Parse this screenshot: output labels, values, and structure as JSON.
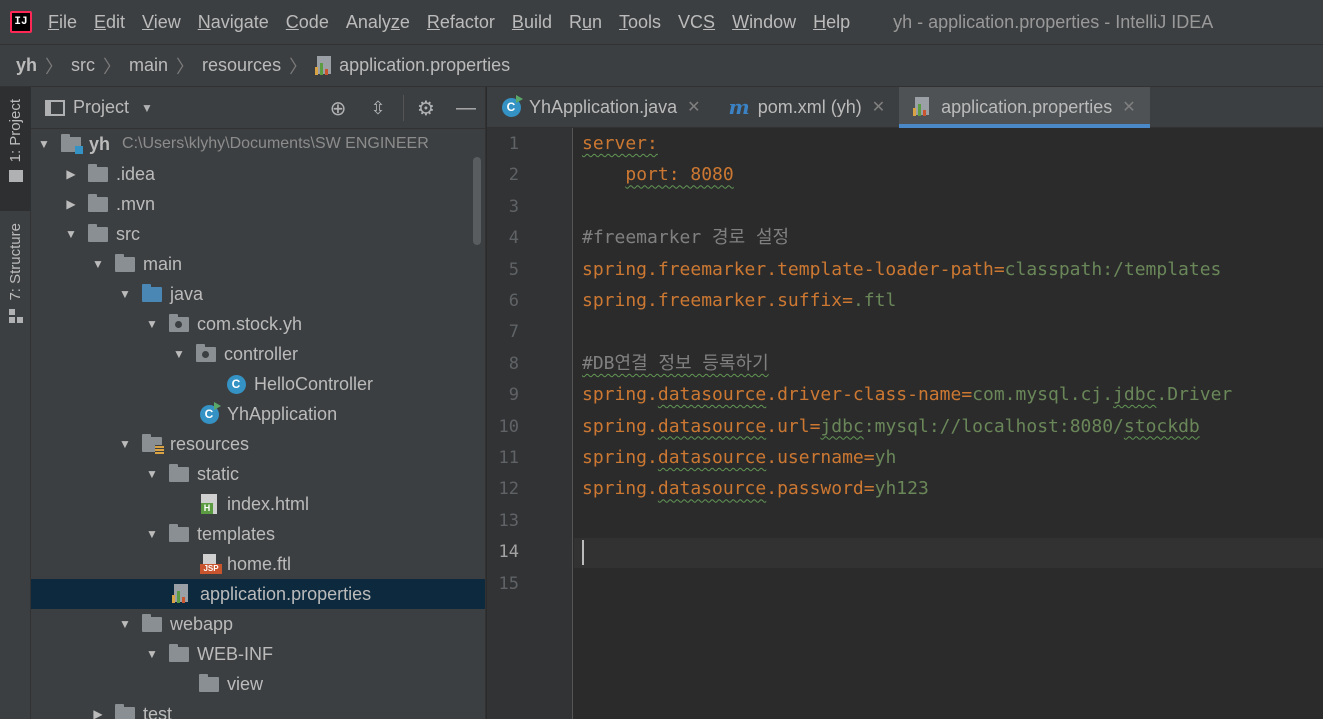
{
  "menu": {
    "items": [
      {
        "pre": "",
        "mn": "F",
        "post": "ile"
      },
      {
        "pre": "",
        "mn": "E",
        "post": "dit"
      },
      {
        "pre": "",
        "mn": "V",
        "post": "iew"
      },
      {
        "pre": "",
        "mn": "N",
        "post": "avigate"
      },
      {
        "pre": "",
        "mn": "C",
        "post": "ode"
      },
      {
        "pre": "Analy",
        "mn": "z",
        "post": "e"
      },
      {
        "pre": "",
        "mn": "R",
        "post": "efactor"
      },
      {
        "pre": "",
        "mn": "B",
        "post": "uild"
      },
      {
        "pre": "R",
        "mn": "u",
        "post": "n"
      },
      {
        "pre": "",
        "mn": "T",
        "post": "ools"
      },
      {
        "pre": "VC",
        "mn": "S",
        "post": ""
      },
      {
        "pre": "",
        "mn": "W",
        "post": "indow"
      },
      {
        "pre": "",
        "mn": "H",
        "post": "elp"
      }
    ],
    "window_title": "yh - application.properties - IntelliJ IDEA",
    "logo_text": "IJ"
  },
  "breadcrumb": [
    "yh",
    "src",
    "main",
    "resources",
    "application.properties"
  ],
  "toolstrip": {
    "project_label": "1: Project",
    "structure_label": "7: Structure"
  },
  "project_panel": {
    "title": "Project",
    "tree": [
      {
        "label": "yh",
        "path": "C:\\Users\\klyhy\\Documents\\SW ENGINEER",
        "indent": 0,
        "arrow": "▼",
        "icon": "folder-module",
        "bold": true
      },
      {
        "label": ".idea",
        "indent": 1,
        "arrow": "▶",
        "icon": "folder"
      },
      {
        "label": ".mvn",
        "indent": 1,
        "arrow": "▶",
        "icon": "folder"
      },
      {
        "label": "src",
        "indent": 1,
        "arrow": "▼",
        "icon": "folder"
      },
      {
        "label": "main",
        "indent": 2,
        "arrow": "▼",
        "icon": "folder"
      },
      {
        "label": "java",
        "indent": 3,
        "arrow": "▼",
        "icon": "folder-src"
      },
      {
        "label": "com.stock.yh",
        "indent": 4,
        "arrow": "▼",
        "icon": "folder-pkg"
      },
      {
        "label": "controller",
        "indent": 5,
        "arrow": "▼",
        "icon": "folder-pkg"
      },
      {
        "label": "HelloController",
        "indent": 7,
        "arrow": "",
        "icon": "class"
      },
      {
        "label": "YhApplication",
        "indent": 6,
        "arrow": "",
        "icon": "class-run"
      },
      {
        "label": "resources",
        "indent": 3,
        "arrow": "▼",
        "icon": "folder-res"
      },
      {
        "label": "static",
        "indent": 4,
        "arrow": "▼",
        "icon": "folder"
      },
      {
        "label": "index.html",
        "indent": 6,
        "arrow": "",
        "icon": "html"
      },
      {
        "label": "templates",
        "indent": 4,
        "arrow": "▼",
        "icon": "folder"
      },
      {
        "label": "home.ftl",
        "indent": 6,
        "arrow": "",
        "icon": "jsp"
      },
      {
        "label": "application.properties",
        "indent": 5,
        "arrow": "",
        "icon": "props",
        "selected": true
      },
      {
        "label": "webapp",
        "indent": 3,
        "arrow": "▼",
        "icon": "folder"
      },
      {
        "label": "WEB-INF",
        "indent": 4,
        "arrow": "▼",
        "icon": "folder"
      },
      {
        "label": "view",
        "indent": 6,
        "arrow": "",
        "icon": "folder"
      },
      {
        "label": "test",
        "indent": 2,
        "arrow": "▶",
        "icon": "folder"
      }
    ]
  },
  "tabs": [
    {
      "label": "YhApplication.java",
      "icon": "class-run",
      "active": false
    },
    {
      "label": "pom.xml (yh)",
      "icon": "maven",
      "active": false
    },
    {
      "label": "application.properties",
      "icon": "props",
      "active": true
    }
  ],
  "editor": {
    "current_line": 14,
    "line_count": 15,
    "lines": [
      [
        {
          "t": "server:",
          "c": "key",
          "w": true
        }
      ],
      [
        {
          "t": "    "
        },
        {
          "t": "port: 8080",
          "c": "key",
          "w": true
        }
      ],
      [],
      [
        {
          "t": "#freemarker 경로 설정",
          "c": "cmt"
        }
      ],
      [
        {
          "t": "spring.freemarker.template-loader-path",
          "c": "key"
        },
        {
          "t": "=",
          "c": "key"
        },
        {
          "t": "classpath:/templates",
          "c": "val"
        }
      ],
      [
        {
          "t": "spring.freemarker.suffix",
          "c": "key"
        },
        {
          "t": "=",
          "c": "key"
        },
        {
          "t": ".ftl",
          "c": "val"
        }
      ],
      [],
      [
        {
          "t": "#DB연결 정보 등록하기",
          "c": "cmt",
          "w": true
        }
      ],
      [
        {
          "t": "spring.",
          "c": "key"
        },
        {
          "t": "datasource",
          "c": "key",
          "w": true
        },
        {
          "t": ".driver-class-name",
          "c": "key"
        },
        {
          "t": "=",
          "c": "key"
        },
        {
          "t": "com.mysql.cj.",
          "c": "val"
        },
        {
          "t": "jdbc",
          "c": "val",
          "w": true
        },
        {
          "t": ".Driver",
          "c": "val"
        }
      ],
      [
        {
          "t": "spring.",
          "c": "key"
        },
        {
          "t": "datasource",
          "c": "key",
          "w": true
        },
        {
          "t": ".url",
          "c": "key"
        },
        {
          "t": "=",
          "c": "key"
        },
        {
          "t": "jdbc",
          "c": "val",
          "w": true
        },
        {
          "t": ":mysql://localhost:8080/",
          "c": "val"
        },
        {
          "t": "stockdb",
          "c": "val",
          "w": true
        }
      ],
      [
        {
          "t": "spring.",
          "c": "key"
        },
        {
          "t": "datasource",
          "c": "key",
          "w": true
        },
        {
          "t": ".username",
          "c": "key"
        },
        {
          "t": "=",
          "c": "key"
        },
        {
          "t": "yh",
          "c": "val"
        }
      ],
      [
        {
          "t": "spring.",
          "c": "key"
        },
        {
          "t": "datasource",
          "c": "key",
          "w": true
        },
        {
          "t": ".password",
          "c": "key"
        },
        {
          "t": "=",
          "c": "key"
        },
        {
          "t": "yh123",
          "c": "val"
        }
      ],
      [],
      [],
      []
    ]
  },
  "colors": {
    "accent": "#4a88c7",
    "selection": "#0d293e",
    "key": "#cc7832",
    "value": "#6a8759",
    "comment": "#808080"
  }
}
